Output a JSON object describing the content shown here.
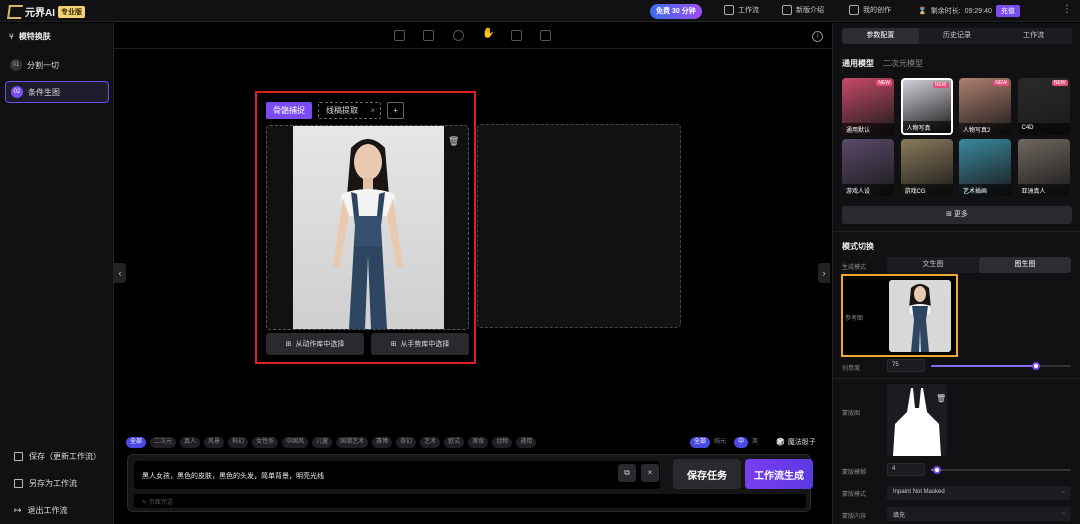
{
  "topbar": {
    "logo_text": "元界AI",
    "pro_badge": "专业版",
    "free_pill": "免费 30 分钟",
    "links": [
      "工作流",
      "新版介绍",
      "我的创作"
    ],
    "remaining_label": "剩余时长:",
    "remaining_time": "09:29:40",
    "recharge_label": "充值"
  },
  "sidebar": {
    "title": "模特换肤",
    "items": [
      {
        "num": "01",
        "label": "分割一切",
        "active": false
      },
      {
        "num": "02",
        "label": "条件生图",
        "active": true
      }
    ],
    "bottom": [
      "保存（更新工作流）",
      "另存为工作流",
      "退出工作流"
    ]
  },
  "canvas": {
    "tabs": {
      "pose": "骨骼捕捉",
      "line": "线稿提取",
      "add": "+"
    },
    "pick_from_library": "从动作库中选择",
    "pick_from_template": "从手势库中选择"
  },
  "style_tags": [
    "全部",
    "二次元",
    "真人",
    "风景",
    "科幻",
    "女性系",
    "中国风",
    "儿童",
    "国潮艺术",
    "赛博",
    "奇幻",
    "艺术",
    "欧式",
    "美食",
    "动物",
    "通用"
  ],
  "right_tags": {
    "all": "全部",
    "pure": "纯元",
    "zh": "中",
    "en": "英"
  },
  "magic_dice": "魔法骰子",
  "prompt": {
    "text": "黑人女孩，黑色的皮肤，黑色的头发，简单背景，明亮光线",
    "save_task": "保存任务",
    "generate": "工作流生成",
    "negative_placeholder": "负面咒语"
  },
  "rpanel": {
    "tabs": [
      "参数配置",
      "历史记录",
      "工作流"
    ],
    "models_heading": "通用模型",
    "models_heading2": "二次元模型",
    "models": [
      {
        "label": "通用默认",
        "new": true,
        "color": "#c84a6a"
      },
      {
        "label": "人物写真",
        "new": true,
        "color": "#d0d0d8"
      },
      {
        "label": "人物写真2",
        "new": true,
        "color": "#b08070"
      },
      {
        "label": "C4D",
        "new": true,
        "color": "#2a2a2a"
      },
      {
        "label": "游戏人设",
        "new": false,
        "color": "#5a4a6a"
      },
      {
        "label": "游戏CG",
        "new": false,
        "color": "#8a7a5a"
      },
      {
        "label": "艺术插画",
        "new": false,
        "color": "#3a8aa0"
      },
      {
        "label": "亚洲真人",
        "new": false,
        "color": "#706860"
      }
    ],
    "new_badge": "NEW",
    "more": "更多",
    "mode_heading": "模式切换",
    "gen_mode_label": "生成模式",
    "gen_modes": [
      "文生图",
      "图生图"
    ],
    "ref_label": "参考图",
    "creativity_label": "创意度",
    "creativity_value": "75",
    "creativity_level": 0.75,
    "mask_label": "蒙版图",
    "mask_blur_label": "蒙版模糊",
    "mask_blur_value": "4",
    "mask_blur_level": 0.04,
    "mask_mode_label": "蒙版模式",
    "mask_mode_value": "Inpaint Not Masked",
    "mask_content_label": "蒙版内容",
    "mask_content_value": "填充"
  }
}
